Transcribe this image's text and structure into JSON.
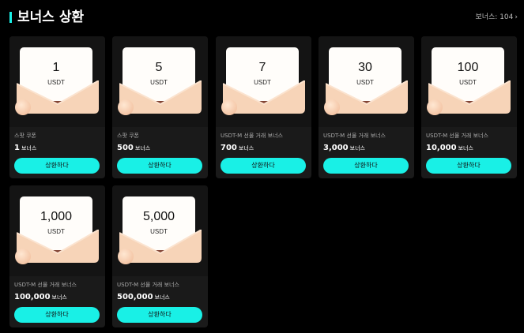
{
  "header": {
    "title": "보너스 상환",
    "more_label": "보너스: 104",
    "more_icon": "chevron-right-icon"
  },
  "colors": {
    "accent": "#19f0e6",
    "card_bg": "#1a1a1a"
  },
  "cards": [
    {
      "amount": "1",
      "unit": "USDT",
      "label": "스팟 쿠폰",
      "value": "1",
      "value_suffix": "보너스",
      "button": "상환하다"
    },
    {
      "amount": "5",
      "unit": "USDT",
      "label": "스팟 쿠폰",
      "value": "500",
      "value_suffix": "보너스",
      "button": "상환하다"
    },
    {
      "amount": "7",
      "unit": "USDT",
      "label": "USDT-M 선물 거래 보너스",
      "value": "700",
      "value_suffix": "보너스",
      "button": "상환하다"
    },
    {
      "amount": "30",
      "unit": "USDT",
      "label": "USDT-M 선물 거래 보너스",
      "value": "3,000",
      "value_suffix": "보너스",
      "button": "상환하다"
    },
    {
      "amount": "100",
      "unit": "USDT",
      "label": "USDT-M 선물 거래 보너스",
      "value": "10,000",
      "value_suffix": "보너스",
      "button": "상환하다"
    },
    {
      "amount": "1,000",
      "unit": "USDT",
      "label": "USDT-M 선물 거래 보너스",
      "value": "100,000",
      "value_suffix": "보너스",
      "button": "상환하다"
    },
    {
      "amount": "5,000",
      "unit": "USDT",
      "label": "USDT-M 선물 거래 보너스",
      "value": "500,000",
      "value_suffix": "보너스",
      "button": "상환하다"
    }
  ]
}
